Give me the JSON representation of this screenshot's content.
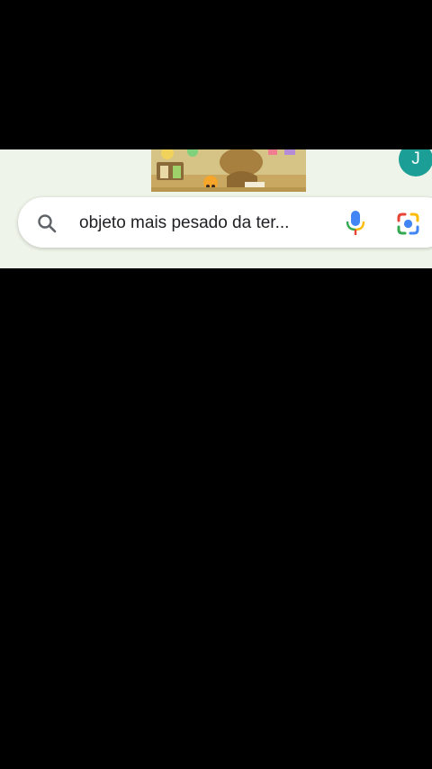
{
  "search": {
    "query": "objeto mais pesado da ter..."
  },
  "account": {
    "avatar_letter": "J"
  },
  "colors": {
    "background": "#000000",
    "strip": "#eef4e9",
    "avatar": "#1a9e96",
    "google_blue": "#4285F4",
    "google_red": "#EA4335",
    "google_yellow": "#FBBC05",
    "google_green": "#34A853"
  },
  "icons": {
    "search": "search-icon",
    "voice": "mic-icon",
    "lens": "google-lens-icon",
    "doodle": "google-doodle-image"
  }
}
